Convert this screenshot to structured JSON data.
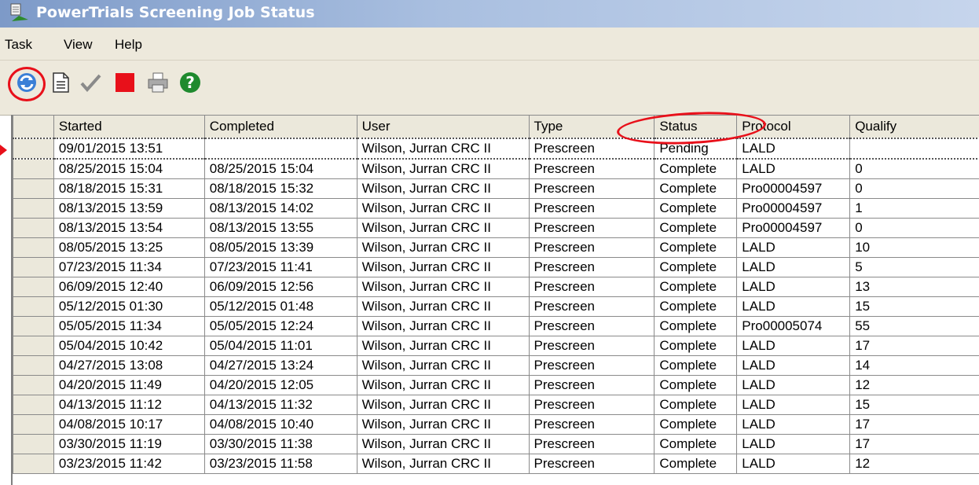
{
  "window": {
    "title": "PowerTrials Screening Job Status",
    "icon": "app-window-icon"
  },
  "menu": {
    "items": [
      {
        "label": "Task"
      },
      {
        "label": "View"
      },
      {
        "label": "Help"
      }
    ]
  },
  "toolbar": {
    "icons": [
      "refresh-icon",
      "document-icon",
      "checkmark-icon",
      "stop-icon",
      "print-icon",
      "help-icon"
    ],
    "colors": {
      "stop": "#e8101a",
      "help": "#1f8a2e",
      "highlight_circle": "#e8101a"
    }
  },
  "grid": {
    "columns": [
      "Started",
      "Completed",
      "User",
      "Type",
      "Status",
      "Protocol",
      "Qualify"
    ],
    "rows": [
      [
        "09/01/2015 13:51",
        "",
        "Wilson, Jurran  CRC II",
        "Prescreen",
        "Pending",
        "LALD",
        ""
      ],
      [
        "08/25/2015 15:04",
        "08/25/2015 15:04",
        "Wilson, Jurran  CRC II",
        "Prescreen",
        "Complete",
        "LALD",
        "0"
      ],
      [
        "08/18/2015 15:31",
        "08/18/2015 15:32",
        "Wilson, Jurran  CRC II",
        "Prescreen",
        "Complete",
        "Pro00004597",
        "0"
      ],
      [
        "08/13/2015 13:59",
        "08/13/2015 14:02",
        "Wilson, Jurran  CRC II",
        "Prescreen",
        "Complete",
        "Pro00004597",
        "1"
      ],
      [
        "08/13/2015 13:54",
        "08/13/2015 13:55",
        "Wilson, Jurran  CRC II",
        "Prescreen",
        "Complete",
        "Pro00004597",
        "0"
      ],
      [
        "08/05/2015 13:25",
        "08/05/2015 13:39",
        "Wilson, Jurran  CRC II",
        "Prescreen",
        "Complete",
        "LALD",
        "10"
      ],
      [
        "07/23/2015 11:34",
        "07/23/2015 11:41",
        "Wilson, Jurran  CRC II",
        "Prescreen",
        "Complete",
        "LALD",
        "5"
      ],
      [
        "06/09/2015 12:40",
        "06/09/2015 12:56",
        "Wilson, Jurran  CRC II",
        "Prescreen",
        "Complete",
        "LALD",
        "13"
      ],
      [
        "05/12/2015 01:30",
        "05/12/2015 01:48",
        "Wilson, Jurran  CRC II",
        "Prescreen",
        "Complete",
        "LALD",
        "15"
      ],
      [
        "05/05/2015 11:34",
        "05/05/2015 12:24",
        "Wilson, Jurran  CRC II",
        "Prescreen",
        "Complete",
        "Pro00005074",
        "55"
      ],
      [
        "05/04/2015 10:42",
        "05/04/2015 11:01",
        "Wilson, Jurran  CRC II",
        "Prescreen",
        "Complete",
        "LALD",
        "17"
      ],
      [
        "04/27/2015 13:08",
        "04/27/2015 13:24",
        "Wilson, Jurran  CRC II",
        "Prescreen",
        "Complete",
        "LALD",
        "14"
      ],
      [
        "04/20/2015 11:49",
        "04/20/2015 12:05",
        "Wilson, Jurran  CRC II",
        "Prescreen",
        "Complete",
        "LALD",
        "12"
      ],
      [
        "04/13/2015 11:12",
        "04/13/2015 11:32",
        "Wilson, Jurran  CRC II",
        "Prescreen",
        "Complete",
        "LALD",
        "15"
      ],
      [
        "04/08/2015 10:17",
        "04/08/2015 10:40",
        "Wilson, Jurran  CRC II",
        "Prescreen",
        "Complete",
        "LALD",
        "17"
      ],
      [
        "03/30/2015 11:19",
        "03/30/2015 11:38",
        "Wilson, Jurran  CRC II",
        "Prescreen",
        "Complete",
        "LALD",
        "17"
      ],
      [
        "03/23/2015 11:42",
        "03/23/2015 11:58",
        "Wilson, Jurran  CRC II",
        "Prescreen",
        "Complete",
        "LALD",
        "12"
      ]
    ]
  }
}
